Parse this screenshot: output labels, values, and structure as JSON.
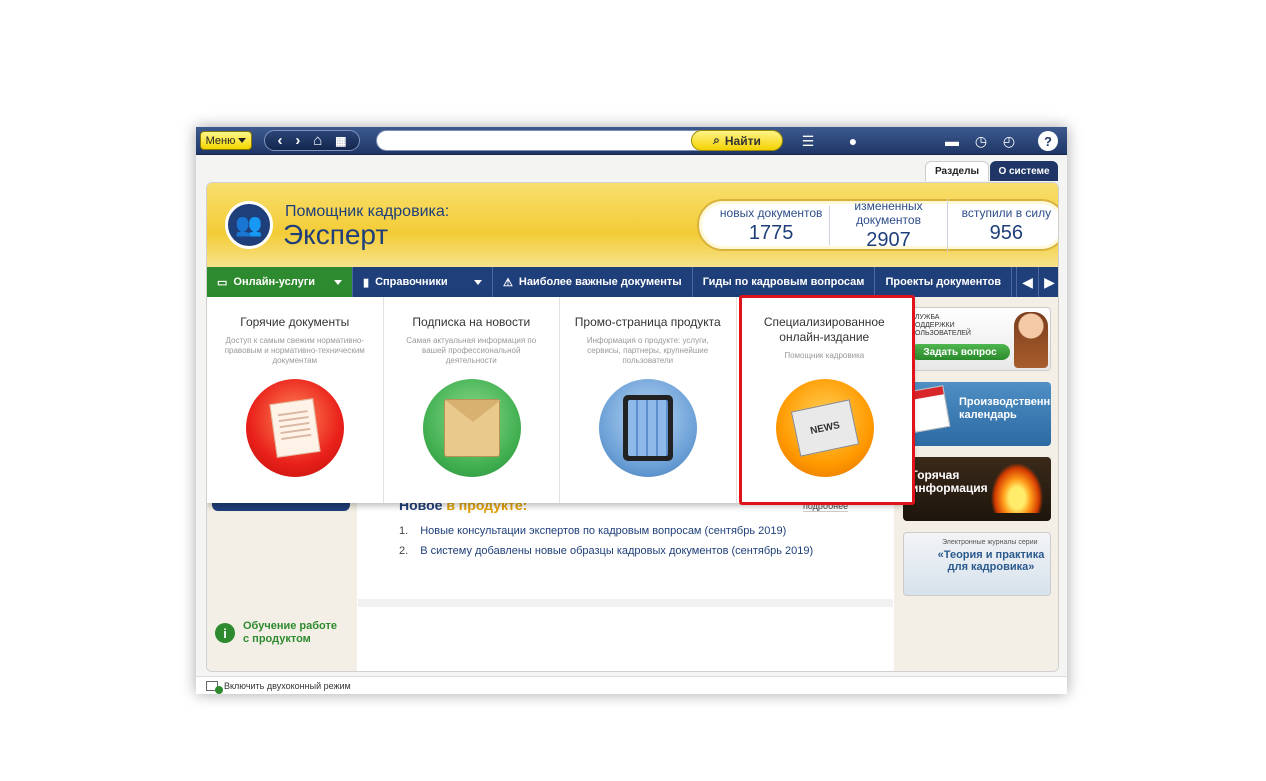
{
  "toolbar": {
    "menu_label": "Меню",
    "find_label": "Найти",
    "search_placeholder": "",
    "help_label": "?"
  },
  "tabs": [
    {
      "label": "Разделы",
      "active": true
    },
    {
      "label": "О системе",
      "active": false
    }
  ],
  "banner": {
    "subtitle": "Помощник кадровика:",
    "title": "Эксперт",
    "stats": [
      {
        "label": "новых документов",
        "value": "1775"
      },
      {
        "label": "измененных документов",
        "value": "2907"
      },
      {
        "label": "вступили в силу",
        "value": "956"
      }
    ]
  },
  "navbar": {
    "items": [
      {
        "label": "Онлайн-услуги",
        "icon": "monitor-icon",
        "has_dropdown": true,
        "active": true
      },
      {
        "label": "Справочники",
        "icon": "book-icon",
        "has_dropdown": true
      },
      {
        "label": "Наиболее важные документы",
        "icon": "warning-doc-icon"
      },
      {
        "label": "Гиды по кадровым вопросам"
      },
      {
        "label": "Проекты документов"
      }
    ]
  },
  "dropdown": {
    "items": [
      {
        "title": "Горячие документы",
        "desc": "Доступ к самым свежим нормативно-правовым и нормативно-техническим документам",
        "icon": "hot-docs-icon"
      },
      {
        "title": "Подписка на новости",
        "desc": "Самая актуальная информация по вашей профессиональной деятельности",
        "icon": "news-envelope-icon"
      },
      {
        "title": "Промо-страница продукта",
        "desc": "Информация о продукте: услуги, сервисы, партнеры, крупнейшие пользователи",
        "icon": "tablet-icon"
      },
      {
        "title": "Специализированное онлайн-издание",
        "desc": "Помощник кадровика",
        "icon": "newspaper-icon",
        "highlighted": true
      }
    ]
  },
  "news": {
    "title_part1": "Новое",
    "title_part2": "в продукте:",
    "more_label": "подробнее",
    "items": [
      "Новые консультации экспертов по кадровым вопросам (сентябрь 2019)",
      "В систему добавлены новые образцы кадровых документов (сентябрь 2019)"
    ]
  },
  "training": {
    "label": "Обучение работе с продуктом"
  },
  "promos": {
    "support_label": "СЛУЖБА ПОДДЕРЖКИ ПОЛЬЗОВАТЕЛЕЙ",
    "support_button": "Задать вопрос",
    "calendar_label": "Производственный календарь",
    "hot_label": "Горячая информация",
    "journal_sub": "Электронные журналы серии",
    "journal_title": "«Теория и практика для кадровика»"
  },
  "statusbar": {
    "label": "Включить двухоконный режим"
  },
  "colors": {
    "brand_blue": "#1f3f7a",
    "accent_yellow": "#f3cc36",
    "online_green": "#2e8a2e",
    "highlight_red": "#e0121a"
  }
}
